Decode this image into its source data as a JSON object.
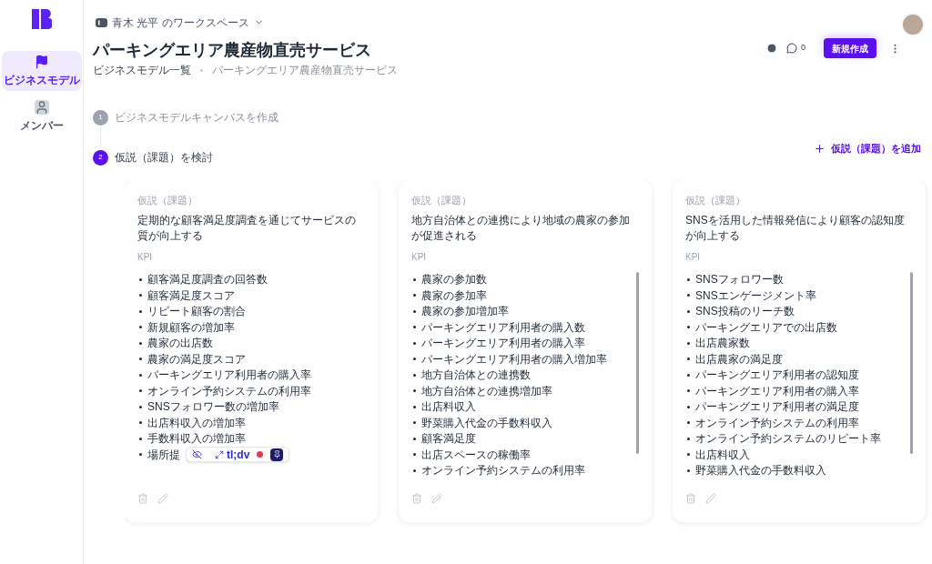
{
  "sidebar": {
    "items": [
      {
        "label": "ビジネスモデル",
        "selected": true
      },
      {
        "label": "メンバー",
        "selected": false
      }
    ]
  },
  "workspace": {
    "label": "青木 光平 のワークスペース"
  },
  "header": {
    "title": "パーキングエリア農産物直売サービス",
    "breadcrumb": [
      "ビジネスモデル一覧",
      "パーキングエリア農産物直売サービス"
    ],
    "comment_count": "0",
    "new_button": "新規作成"
  },
  "steps": [
    {
      "number": "1",
      "label": "ビジネスモデルキャンバスを作成",
      "selected": false
    },
    {
      "number": "2",
      "label": "仮説（課題）を検討",
      "selected": true
    }
  ],
  "add_button": "仮説（課題）を追加",
  "cards": [
    {
      "heading": "仮説（課題）",
      "text": "定期的な顧客満足度調査を通じてサービスの質が向上する",
      "kpi_label": "KPI",
      "scrollable": false,
      "kpis": [
        "顧客満足度調査の回答数",
        "顧客満足度スコア",
        "リピート顧客の割合",
        "新規顧客の増加率",
        "農家の出店数",
        "農家の満足度スコア",
        "パーキングエリア利用者の購入率",
        "オンライン予約システムの利用率",
        "SNSフォロワー数の増加率",
        "出店料収入の増加率",
        "手数料収入の増加率",
        "場所提"
      ]
    },
    {
      "heading": "仮説（課題）",
      "text": "地方自治体との連携により地域の農家の参加が促進される",
      "kpi_label": "KPI",
      "scrollable": true,
      "kpis": [
        "農家の参加数",
        "農家の参加率",
        "農家の参加増加率",
        "パーキングエリア利用者の購入数",
        "パーキングエリア利用者の購入率",
        "パーキングエリア利用者の購入増加率",
        "地方自治体との連携数",
        "地方自治体との連携増加率",
        "出店料収入",
        "野菜購入代金の手数料収入",
        "顧客満足度",
        "出店スペースの稼働率",
        "オンライン予約システムの利用率"
      ]
    },
    {
      "heading": "仮説（課題）",
      "text": "SNSを活用した情報発信により顧客の認知度が向上する",
      "kpi_label": "KPI",
      "scrollable": true,
      "kpis": [
        "SNSフォロワー数",
        "SNSエンゲージメント率",
        "SNS投稿のリーチ数",
        "パーキングエリアでの出店数",
        "出店農家数",
        "出店農家の満足度",
        "パーキングエリア利用者の認知度",
        "パーキングエリア利用者の購入率",
        "パーキングエリア利用者の満足度",
        "オンライン予約システムの利用率",
        "オンライン予約システムのリピート率",
        "出店料収入",
        "野菜購入代金の手数料収入"
      ]
    }
  ],
  "overlay": {
    "brand": "tl;dv",
    "recording": true
  }
}
